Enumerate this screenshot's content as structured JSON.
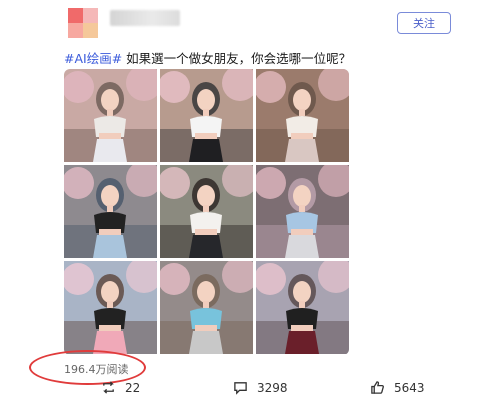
{
  "post": {
    "follow_label": "关注",
    "hashtag": "#AI绘画#",
    "text": " 如果選一个做女朋友，你会选哪一位呢？",
    "images": [
      {
        "icon": "portrait-photo"
      },
      {
        "icon": "portrait-photo"
      },
      {
        "icon": "portrait-photo"
      },
      {
        "icon": "portrait-photo"
      },
      {
        "icon": "portrait-photo"
      },
      {
        "icon": "portrait-photo"
      },
      {
        "icon": "portrait-photo"
      },
      {
        "icon": "portrait-photo"
      },
      {
        "icon": "portrait-photo"
      }
    ],
    "reads": "196.4万阅读"
  },
  "actions": {
    "repost_count": "22",
    "comment_count": "3298",
    "like_count": "5643"
  },
  "colors": {
    "accent": "#3b5bdb",
    "highlight": "#e03b3b"
  }
}
